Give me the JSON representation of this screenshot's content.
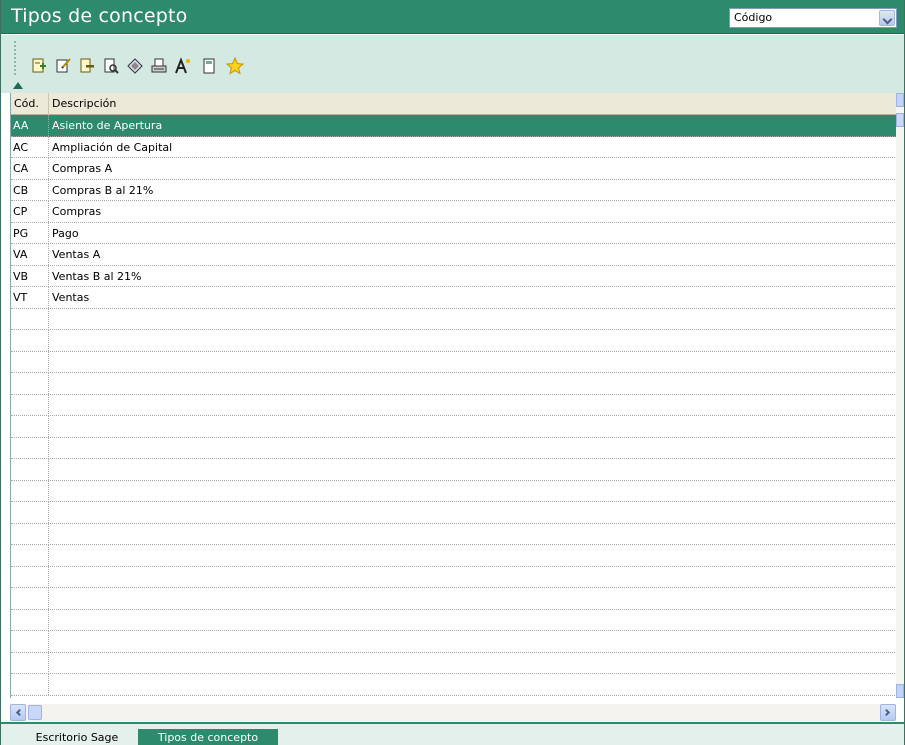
{
  "window": {
    "title": "Tipos de concepto",
    "sort_field": "Código"
  },
  "toolbar": {
    "buttons": [
      {
        "name": "new-icon"
      },
      {
        "name": "edit-icon"
      },
      {
        "name": "delete-icon"
      },
      {
        "name": "search-icon"
      },
      {
        "name": "filter-icon"
      },
      {
        "name": "print-icon"
      },
      {
        "name": "font-icon"
      },
      {
        "name": "calculator-icon"
      },
      {
        "name": "favorite-star-icon"
      }
    ]
  },
  "grid": {
    "columns": [
      "Cód.",
      "Descripción"
    ],
    "rows": [
      {
        "code": "AA",
        "desc": "Asiento de Apertura",
        "selected": true
      },
      {
        "code": "AC",
        "desc": "Ampliación de Capital"
      },
      {
        "code": "CA",
        "desc": "Compras A"
      },
      {
        "code": "CB",
        "desc": "Compras B al 21%"
      },
      {
        "code": "CP",
        "desc": "Compras"
      },
      {
        "code": "PG",
        "desc": "Pago"
      },
      {
        "code": "VA",
        "desc": "Ventas A"
      },
      {
        "code": "VB",
        "desc": "Ventas B al 21%"
      },
      {
        "code": "VT",
        "desc": "Ventas"
      }
    ]
  },
  "tabs": [
    {
      "label": "Escritorio Sage",
      "active": false
    },
    {
      "label": "Tipos de concepto",
      "active": true
    }
  ],
  "colors": {
    "accent": "#2d8a6c",
    "toolbar_bg": "#d3e9e2"
  }
}
